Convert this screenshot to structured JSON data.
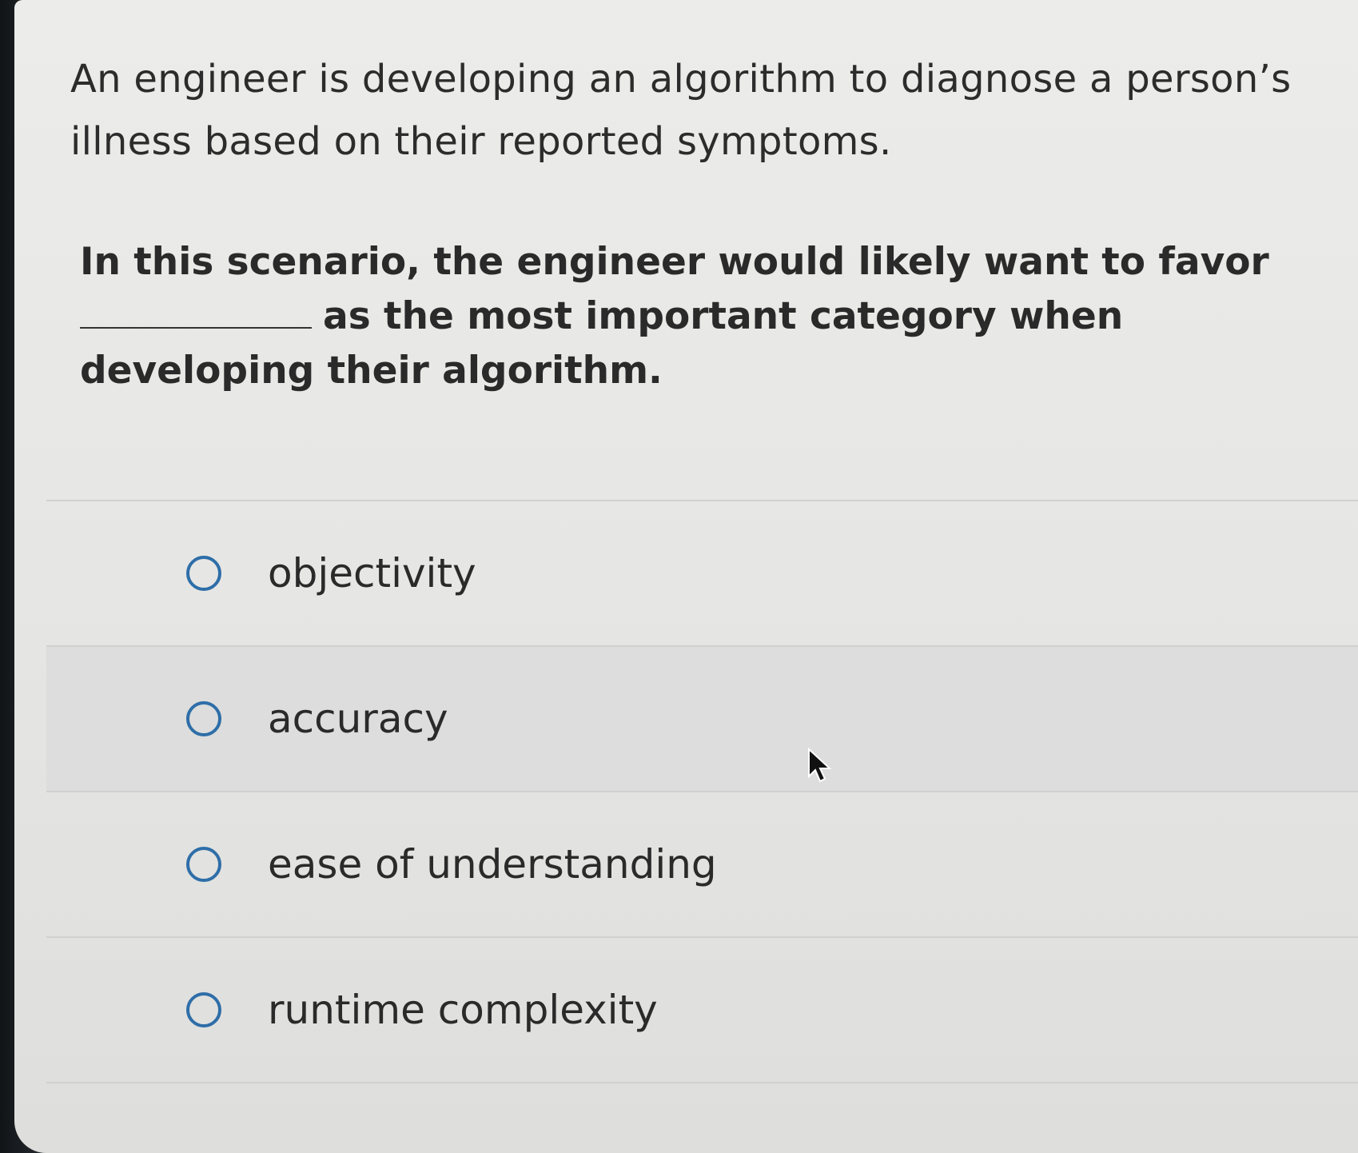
{
  "question": {
    "intro": "An engineer is developing an algorithm to diagnose a person’s illness based on their reported symptoms.",
    "prompt_start": "In this scenario, the engineer would likely want to favor",
    "prompt_end": "as the most important category when developing their algorithm."
  },
  "options": [
    {
      "label": "objectivity"
    },
    {
      "label": "accuracy"
    },
    {
      "label": "ease of understanding"
    },
    {
      "label": "runtime complexity"
    }
  ],
  "colors": {
    "radio_border": "#2e6ea8",
    "text": "#2a2a2a"
  }
}
